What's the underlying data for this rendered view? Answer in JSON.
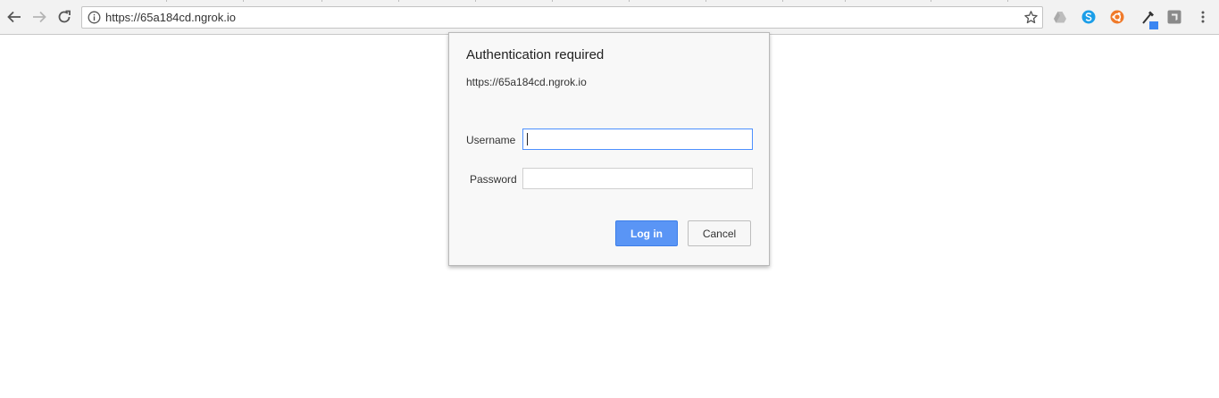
{
  "browser": {
    "url": "https://65a184cd.ngrok.io",
    "back_icon": "back-arrow-icon",
    "forward_icon": "forward-arrow-icon",
    "reload_icon": "reload-icon",
    "info_icon": "info-icon",
    "bookmark_icon": "star-icon",
    "extensions": [
      "google-drive-icon",
      "skype-icon",
      "ubuntu-extension-icon",
      "color-picker-icon",
      "extension-icon"
    ],
    "menu_icon": "kebab-menu-icon"
  },
  "dialog": {
    "title": "Authentication required",
    "origin": "https://65a184cd.ngrok.io",
    "username_label": "Username",
    "username_value": "",
    "password_label": "Password",
    "password_value": "",
    "login_label": "Log in",
    "cancel_label": "Cancel"
  },
  "colors": {
    "primary_button": "#5a95f5",
    "focus_border": "#4d90fe",
    "skype": "#1b9ee8",
    "orange_ext": "#f07a2a"
  }
}
